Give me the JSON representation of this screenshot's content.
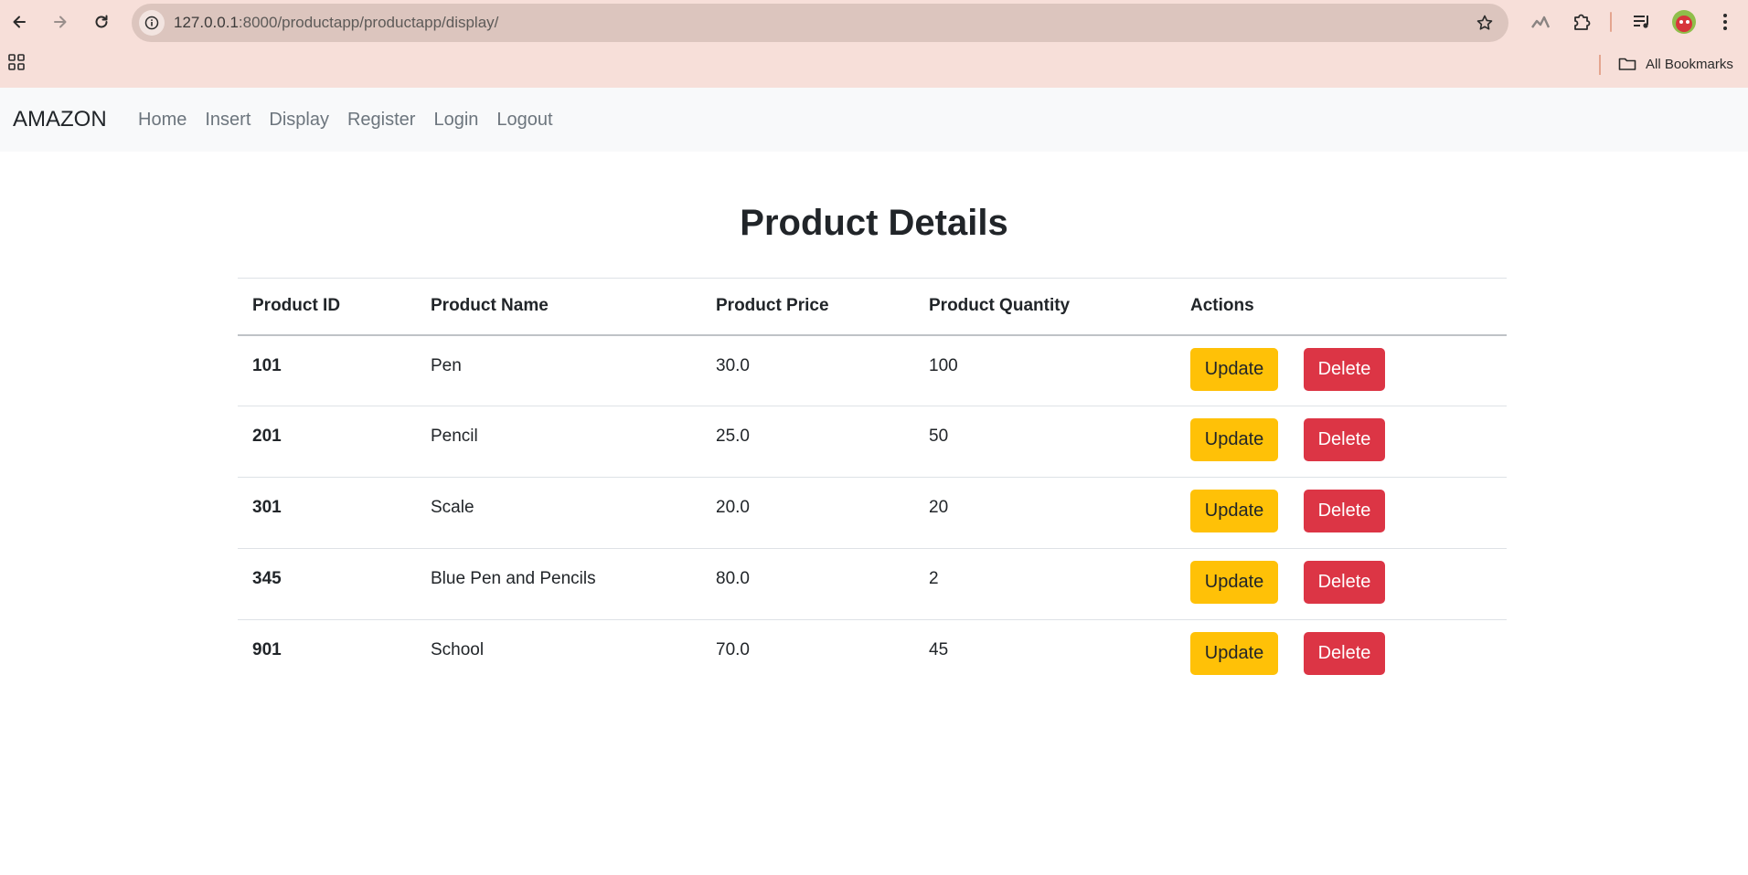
{
  "browser": {
    "url_host": "127.0.0.1",
    "url_rest": ":8000/productapp/productapp/display/",
    "bookmarks_label": "All Bookmarks"
  },
  "navbar": {
    "brand": "AMAZON",
    "links": [
      "Home",
      "Insert",
      "Display",
      "Register",
      "Login",
      "Logout"
    ]
  },
  "main": {
    "title": "Product Details",
    "columns": [
      "Product ID",
      "Product Name",
      "Product Price",
      "Product Quantity",
      "Actions"
    ],
    "rows": [
      {
        "id": "101",
        "name": "Pen",
        "price": "30.0",
        "quantity": "100"
      },
      {
        "id": "201",
        "name": "Pencil",
        "price": "25.0",
        "quantity": "50"
      },
      {
        "id": "301",
        "name": "Scale",
        "price": "20.0",
        "quantity": "20"
      },
      {
        "id": "345",
        "name": "Blue Pen and Pencils",
        "price": "80.0",
        "quantity": "2"
      },
      {
        "id": "901",
        "name": "School",
        "price": "70.0",
        "quantity": "45"
      }
    ],
    "update_label": "Update",
    "delete_label": "Delete"
  },
  "colors": {
    "update": "#ffc107",
    "delete": "#dc3545",
    "navbar_bg": "#f8f9fa",
    "chrome_bg": "#f7dfd9"
  }
}
